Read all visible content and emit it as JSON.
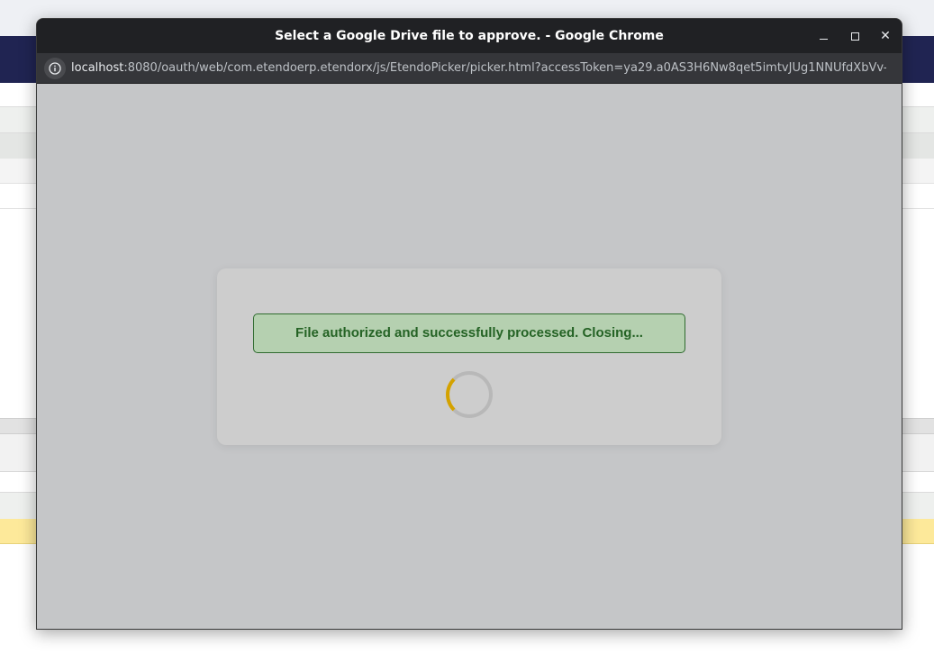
{
  "popup": {
    "window_title": "Select a Google Drive file to approve. - Google Chrome",
    "controls": {
      "minimize_icon": "minimize-icon",
      "maximize_icon": "maximize-icon",
      "close_glyph": "✕"
    },
    "address": {
      "host": "localhost",
      "rest": ":8080/oauth/web/com.etendoerp.etendorx/js/EtendoPicker/picker.html?accessToken=ya29.a0AS3H6Nw8qet5imtvJUg1NNUfdXbVv-..."
    }
  },
  "card": {
    "status_message": "File authorized and successfully processed. Closing...",
    "spinner_icon": "loading-spinner-icon"
  },
  "background": {
    "nav_icon_glyph": "↦"
  },
  "colors": {
    "navbar": "#202452",
    "success_text": "#256325",
    "success_bg": "#b5d0b0",
    "spinner_accent": "#d4a200",
    "highlight_row": "#fde99a"
  }
}
